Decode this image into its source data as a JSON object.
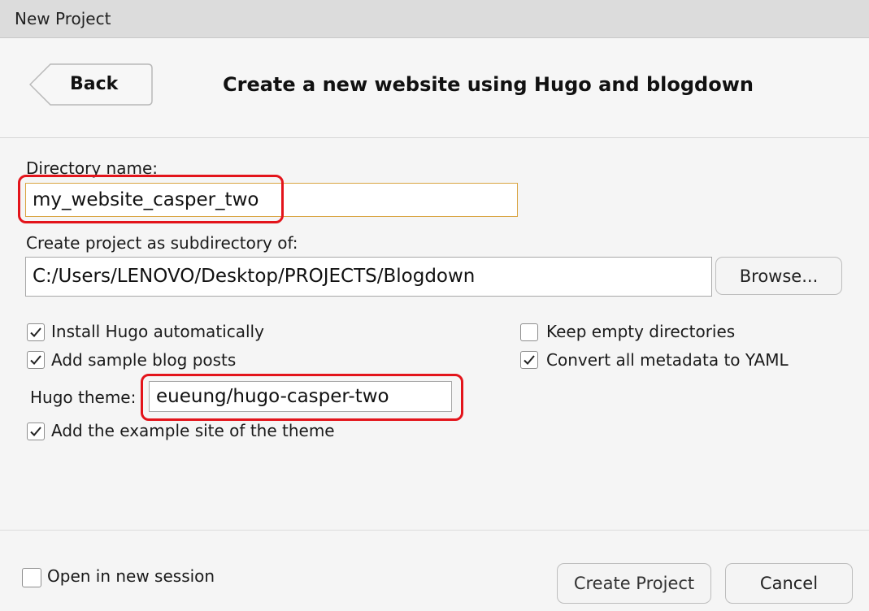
{
  "window": {
    "title": "New Project"
  },
  "header": {
    "back_label": "Back",
    "title": "Create a new website using Hugo and blogdown"
  },
  "form": {
    "directory_label": "Directory name:",
    "directory_value": "my_website_casper_two",
    "subdirectory_label": "Create project as subdirectory of:",
    "subdirectory_value": "C:/Users/LENOVO/Desktop/PROJECTS/Blogdown",
    "browse_label": "Browse...",
    "options": {
      "install_hugo": {
        "label": "Install Hugo automatically",
        "checked": true
      },
      "add_sample_posts": {
        "label": "Add sample blog posts",
        "checked": true
      },
      "keep_empty_dirs": {
        "label": "Keep empty directories",
        "checked": false
      },
      "convert_yaml": {
        "label": "Convert all metadata to YAML",
        "checked": true
      },
      "add_example_site": {
        "label": "Add the example site of the theme",
        "checked": true
      }
    },
    "theme_label": "Hugo theme:",
    "theme_value": "eueung/hugo-casper-two"
  },
  "footer": {
    "open_new_session": {
      "label": "Open in new session",
      "checked": false
    },
    "create_label": "Create Project",
    "cancel_label": "Cancel"
  },
  "colors": {
    "highlight": "#e3141b",
    "focus_border": "#d9a441"
  }
}
